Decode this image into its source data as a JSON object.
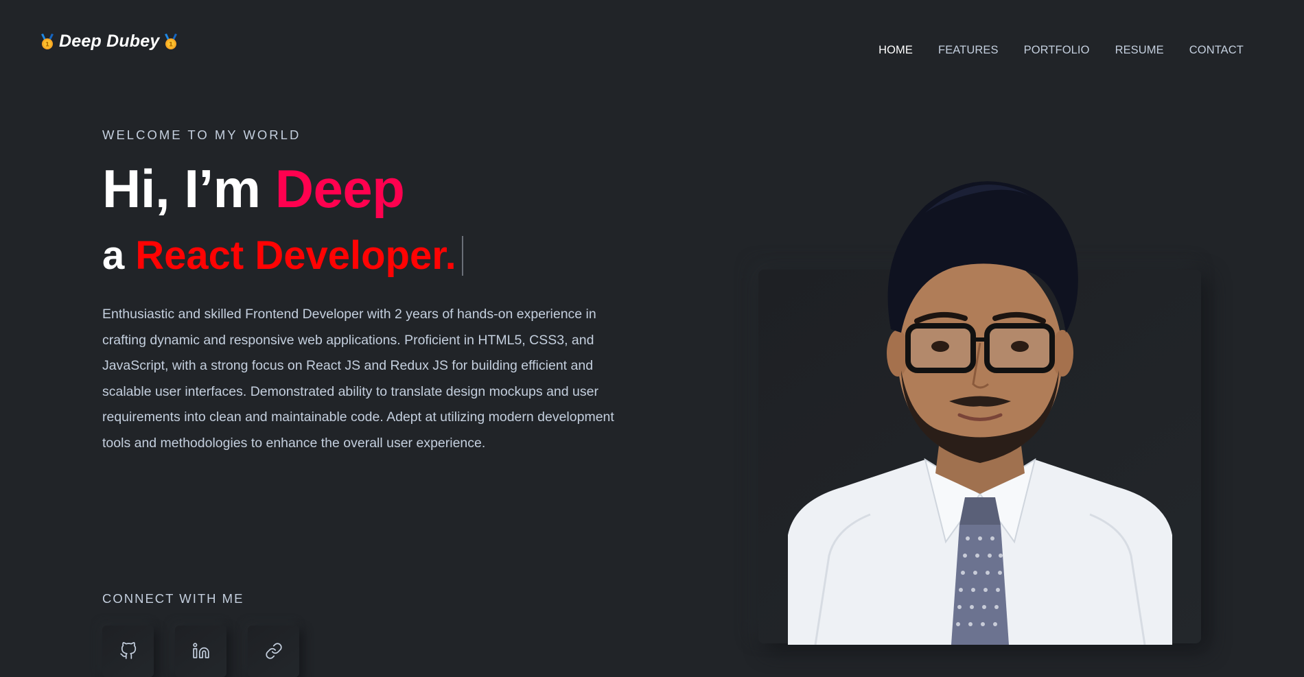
{
  "header": {
    "brand_name": "Deep Dubey",
    "brand_icon_left": "medal-icon",
    "brand_icon_right": "medal-icon",
    "nav": [
      {
        "label": "HOME",
        "active": true
      },
      {
        "label": "FEATURES",
        "active": false
      },
      {
        "label": "PORTFOLIO",
        "active": false
      },
      {
        "label": "RESUME",
        "active": false
      },
      {
        "label": "CONTACT",
        "active": false
      }
    ]
  },
  "hero": {
    "welcome": "WELCOME TO MY WORLD",
    "greeting": "Hi, I’m",
    "name": "Deep",
    "role_prefix": "a",
    "role": "React Developer.",
    "bio": "Enthusiastic and skilled Frontend Developer with 2 years of hands-on experience in crafting dynamic and responsive web applications. Proficient in HTML5, CSS3, and JavaScript, with a strong focus on React JS and Redux JS for building efficient and scalable user interfaces. Demonstrated ability to translate design mockups and user requirements into clean and maintainable code. Adept at utilizing modern development tools and methodologies to enhance the overall user experience."
  },
  "connect": {
    "title": "CONNECT WITH ME",
    "links": [
      {
        "icon": "github-icon"
      },
      {
        "icon": "linkedin-icon"
      },
      {
        "icon": "link-icon"
      }
    ]
  },
  "colors": {
    "background": "#212428",
    "accent_name": "#ff014f",
    "accent_role": "#ff0303",
    "text": "#c4cfde",
    "heading": "#ffffff"
  }
}
